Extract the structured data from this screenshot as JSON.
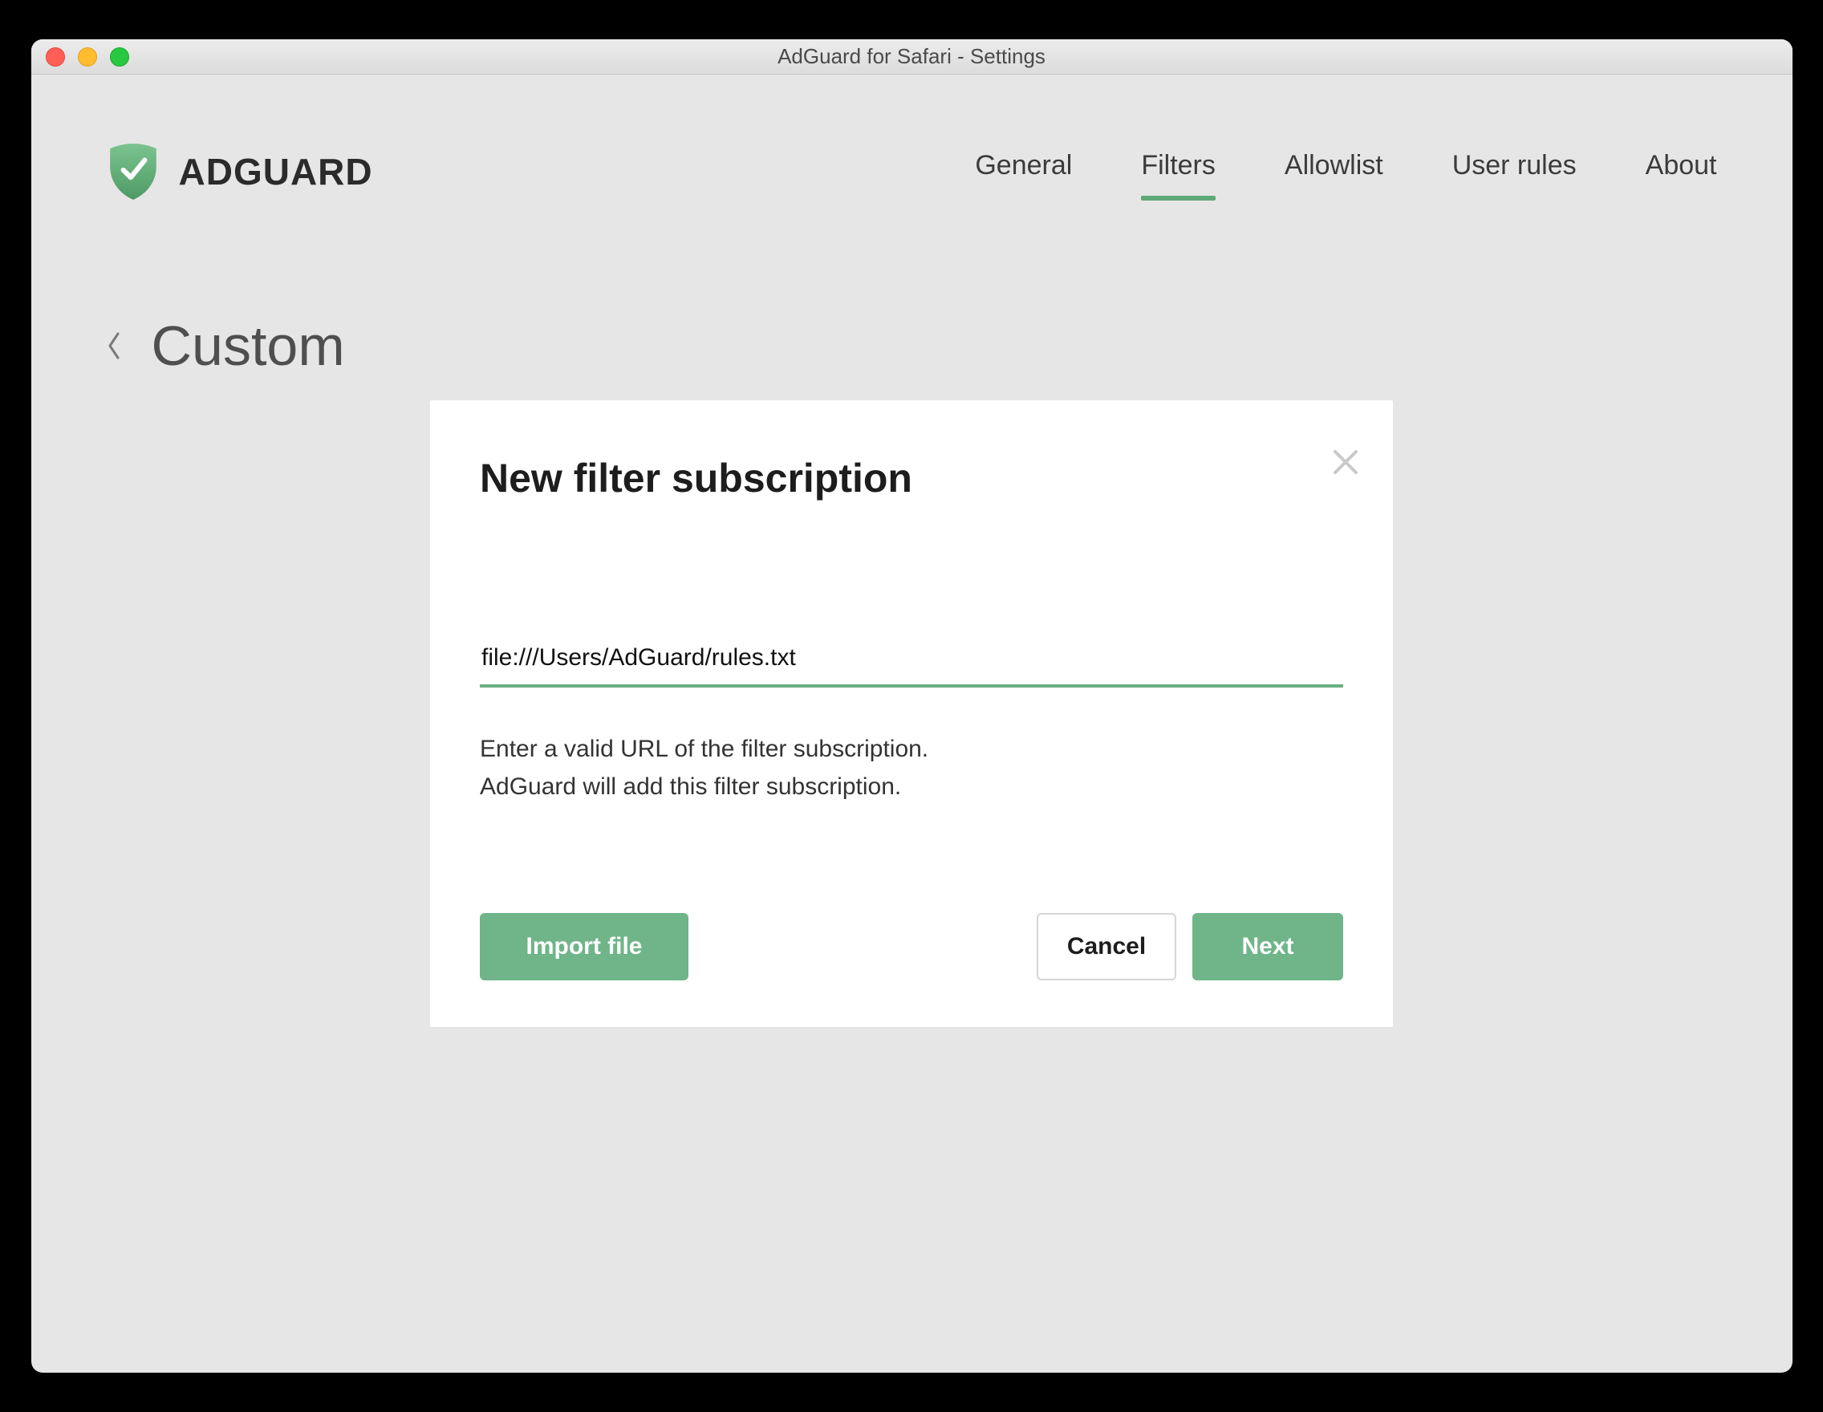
{
  "window": {
    "title": "AdGuard for Safari - Settings"
  },
  "brand": {
    "name": "ADGUARD"
  },
  "nav": {
    "items": [
      {
        "label": "General",
        "active": false
      },
      {
        "label": "Filters",
        "active": true
      },
      {
        "label": "Allowlist",
        "active": false
      },
      {
        "label": "User rules",
        "active": false
      },
      {
        "label": "About",
        "active": false
      }
    ]
  },
  "page": {
    "title": "Custom"
  },
  "modal": {
    "title": "New filter subscription",
    "url_value": "file:///Users/AdGuard/rules.txt",
    "helper_line1": "Enter a valid URL of the filter subscription.",
    "helper_line2": "AdGuard will add this filter subscription.",
    "import_label": "Import file",
    "cancel_label": "Cancel",
    "next_label": "Next"
  },
  "colors": {
    "accent": "#6fb589"
  }
}
